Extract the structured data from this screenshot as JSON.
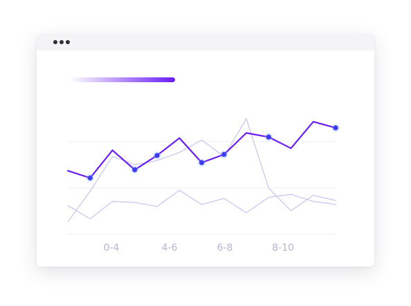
{
  "window": {
    "titlebar_dots": 3
  },
  "colors": {
    "accent": "#6a1cf5",
    "accent_fade_start": "#ffffff",
    "point_fill": "#3f3cf0",
    "point_glow": "#7fb0ff",
    "secondary_line": "#c2c0ec",
    "grid": "#ececf2",
    "tick_text": "#b4b7d2"
  },
  "chart_data": {
    "type": "line",
    "xticks": [
      "0-4",
      "4-6",
      "6-8",
      "8-10"
    ],
    "grid": true,
    "series": [
      {
        "role": "primary",
        "values": [
          62,
          55,
          82,
          63,
          77,
          94,
          70,
          78,
          99,
          95,
          84,
          110,
          104
        ],
        "markers": [
          1,
          3,
          4,
          6,
          7,
          9,
          12
        ]
      },
      {
        "role": "secondary",
        "values": [
          12,
          42,
          76,
          68,
          72,
          80,
          92,
          76,
          113,
          45,
          23,
          38,
          33
        ],
        "markers": []
      },
      {
        "role": "secondary",
        "values": [
          28,
          15,
          32,
          31,
          27,
          43,
          29,
          35,
          21,
          36,
          39,
          32,
          29
        ],
        "markers": []
      }
    ]
  }
}
